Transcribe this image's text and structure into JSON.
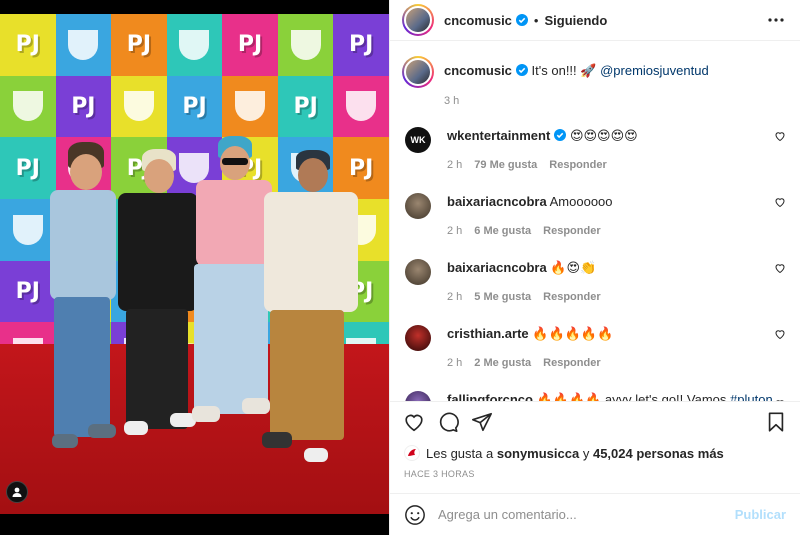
{
  "header": {
    "username": "cncomusic",
    "separator": "•",
    "follow_status": "Siguiendo"
  },
  "caption": {
    "username": "cncomusic",
    "text": "It's on!!! 🚀",
    "mention": "@premiosjuventud",
    "time": "3 h"
  },
  "comments": [
    {
      "username": "wkentertainment",
      "verified": true,
      "text": "😍😍😍😍😍",
      "time": "2 h",
      "likes": "79 Me gusta",
      "reply": "Responder",
      "avatar_color": "#111111",
      "avatar_text": "WK"
    },
    {
      "username": "baixariacncobra",
      "verified": false,
      "text": "Amoooooo",
      "time": "2 h",
      "likes": "6 Me gusta",
      "reply": "Responder",
      "avatar_color": "#5a4a3a",
      "avatar_text": ""
    },
    {
      "username": "baixariacncobra",
      "verified": false,
      "text": "🔥😍👏",
      "time": "2 h",
      "likes": "5 Me gusta",
      "reply": "Responder",
      "avatar_color": "#5a4a3a",
      "avatar_text": ""
    },
    {
      "username": "cristhian.arte",
      "verified": false,
      "text": "🔥🔥🔥🔥🔥",
      "time": "2 h",
      "likes": "2 Me gusta",
      "reply": "Responder",
      "avatar_color": "#6b0d0d",
      "avatar_text": ""
    },
    {
      "username": "fallingforcnco",
      "verified": false,
      "text": "🔥🔥🔥🔥 ayyy let's go!! Vamos",
      "hashtag": "#pluton",
      "avatar_color": "#4b2a6e",
      "avatar_text": ""
    }
  ],
  "likes": {
    "prefix": "Les gusta a",
    "user": "sonymusicca",
    "connector": "y",
    "others": "45,024 personas más"
  },
  "timestamp": "HACE 3 HORAS",
  "composer": {
    "placeholder": "Agrega un comentario...",
    "post_label": "Publicar"
  },
  "photo": {
    "tile_letters": "PJ",
    "tile_colors": [
      "#e8e02a",
      "#e8308a",
      "#3aa6e0",
      "#8ad13a",
      "#f08a1e",
      "#7a3fd6",
      "#2ec7b8"
    ]
  },
  "colors": {
    "verified": "#0095f6",
    "link": "#00376b",
    "muted": "#8e8e8e",
    "post_disabled": "#b2dffc"
  }
}
